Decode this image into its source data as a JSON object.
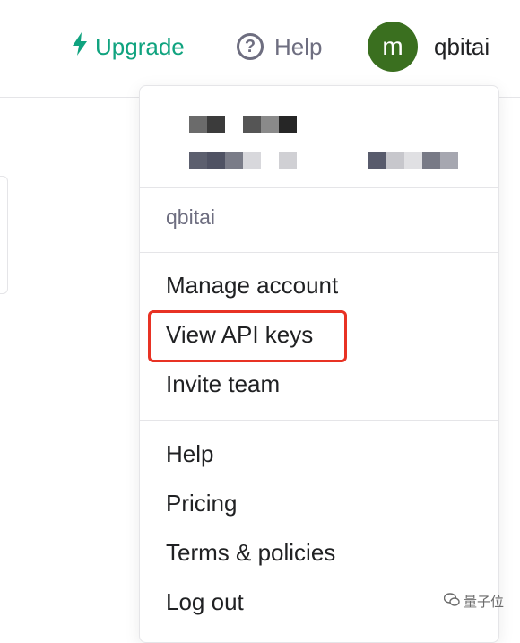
{
  "header": {
    "upgrade_label": "Upgrade",
    "help_label": "Help",
    "avatar_letter": "m",
    "username": "qbitai",
    "accent_color": "#10a37f",
    "avatar_color": "#3a6f1f"
  },
  "dropdown": {
    "account_name": "qbitai",
    "items": [
      {
        "label": "Manage account"
      },
      {
        "label": "View API keys"
      },
      {
        "label": "Invite team"
      },
      {
        "label": "Help"
      },
      {
        "label": "Pricing"
      },
      {
        "label": "Terms & policies"
      },
      {
        "label": "Log out"
      }
    ],
    "highlighted_item": "View API keys",
    "highlight_color": "#e83224"
  },
  "watermark": {
    "text": "量子位"
  }
}
